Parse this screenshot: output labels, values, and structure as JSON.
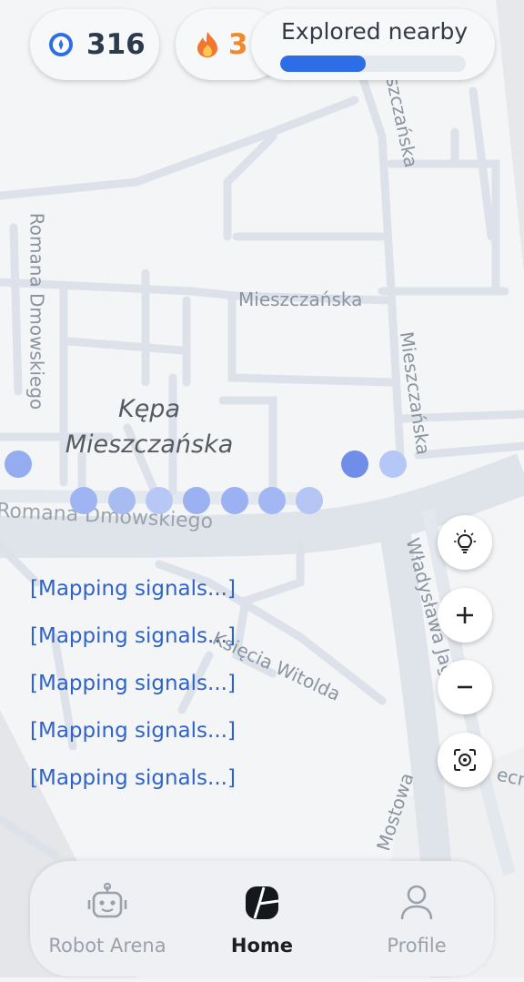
{
  "stats": {
    "points": "316",
    "points_icon": "compass-badge-icon",
    "streak": "3",
    "streak_icon": "flame-icon"
  },
  "explore": {
    "title": "Explored nearby",
    "progress": 0.46
  },
  "map": {
    "district_line1": "Kępa",
    "district_line2": "Mieszczańska",
    "streets": {
      "top_vertical": "Mieszczańska",
      "mid_horizontal": "Mieszczańska",
      "right_vertical": "Mieszczańska",
      "left_vertical": "Romana Dmowskiego",
      "main_road": "Romana Dmowskiego",
      "lower_diagonal": "Księcia Witolda",
      "right_diagonal": "Władysława Jagiełły",
      "bottom_right": "Mostowa",
      "edge_right": "ecn"
    }
  },
  "mapping_signals": [
    "[Mapping signals...]",
    "[Mapping signals...]",
    "[Mapping signals...]",
    "[Mapping signals...]",
    "[Mapping signals...]"
  ],
  "map_controls": {
    "hint_icon": "lightbulb-icon",
    "zoom_in_icon": "plus-icon",
    "zoom_out_icon": "minus-icon",
    "locate_icon": "locate-target-icon"
  },
  "nav": {
    "items": [
      {
        "label": "Robot Arena",
        "icon": "robot-icon",
        "active": false
      },
      {
        "label": "Home",
        "icon": "map-icon",
        "active": true
      },
      {
        "label": "Profile",
        "icon": "person-icon",
        "active": false
      }
    ]
  },
  "colors": {
    "accent": "#2d6ee6",
    "link": "#2f63c9",
    "streak": "#f08a2b"
  }
}
